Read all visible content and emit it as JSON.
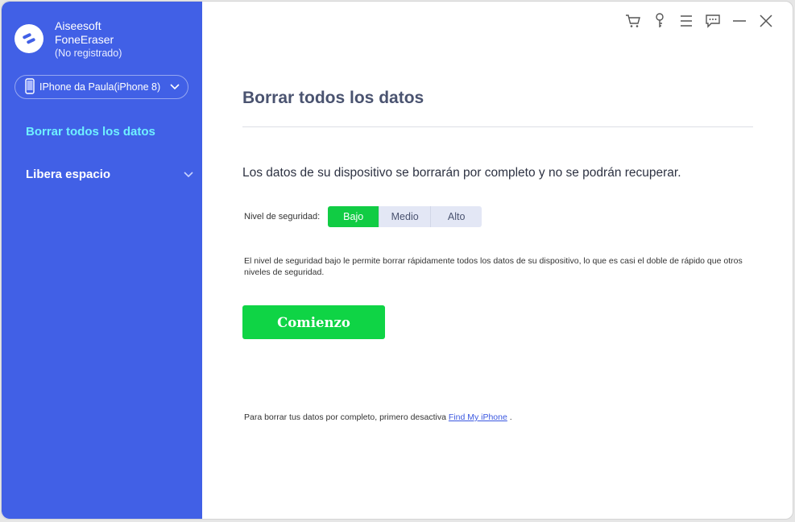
{
  "app": {
    "brand": "Aiseesoft",
    "product": "FoneEraser",
    "status": "(No registrado)",
    "accent_color": "#4160e6",
    "active_nav_color": "#6ff0ff",
    "primary_button_color": "#0fd445"
  },
  "device": {
    "name": "IPhone da Paula(iPhone 8)",
    "icon": "phone-icon"
  },
  "sidebar": {
    "items": [
      {
        "label": "Borrar todos los datos",
        "active": true
      },
      {
        "label": "Libera espacio",
        "active": false,
        "icon": "chevron-down-icon"
      }
    ]
  },
  "toolbar": {
    "icons": [
      "cart-icon",
      "key-icon",
      "menu-icon",
      "feedback-icon",
      "minimize-icon",
      "close-icon"
    ]
  },
  "main": {
    "title": "Borrar todos los datos",
    "description": "Los datos de su dispositivo se borrarán por completo y no se podrán recuperar.",
    "security": {
      "label": "Nivel de seguridad:",
      "options": [
        "Bajo",
        "Medio",
        "Alto"
      ],
      "selected": "Bajo"
    },
    "note": "El nivel de seguridad bajo le permite borrar rápidamente todos los datos de su dispositivo, lo que es casi el doble de rápido que otros niveles de seguridad.",
    "start_label": "Comienzo",
    "footer": {
      "prefix": "Para borrar tus datos por completo, primero desactiva ",
      "link": "Find My iPhone",
      "suffix": " ."
    }
  }
}
